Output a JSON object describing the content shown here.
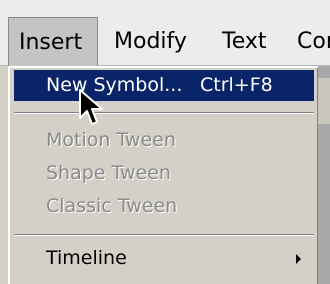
{
  "menubar": {
    "items": [
      {
        "label": "Insert"
      },
      {
        "label": "Modify"
      },
      {
        "label": "Text"
      },
      {
        "label": "Cor"
      }
    ]
  },
  "menu": {
    "new_symbol": {
      "label": "New Symbol...",
      "shortcut": "Ctrl+F8"
    },
    "motion_tween": {
      "label": "Motion Tween"
    },
    "shape_tween": {
      "label": "Shape Tween"
    },
    "classic_tween": {
      "label": "Classic Tween"
    },
    "timeline": {
      "label": "Timeline"
    }
  },
  "colors": {
    "highlight": "#0a246a",
    "menu_bg": "#d4d0c8",
    "menubar_bg": "#ececec",
    "disabled_text": "#8a8a8a"
  },
  "icons": {
    "cursor": "mouse-pointer-icon",
    "submenu": "submenu-arrow-icon"
  }
}
